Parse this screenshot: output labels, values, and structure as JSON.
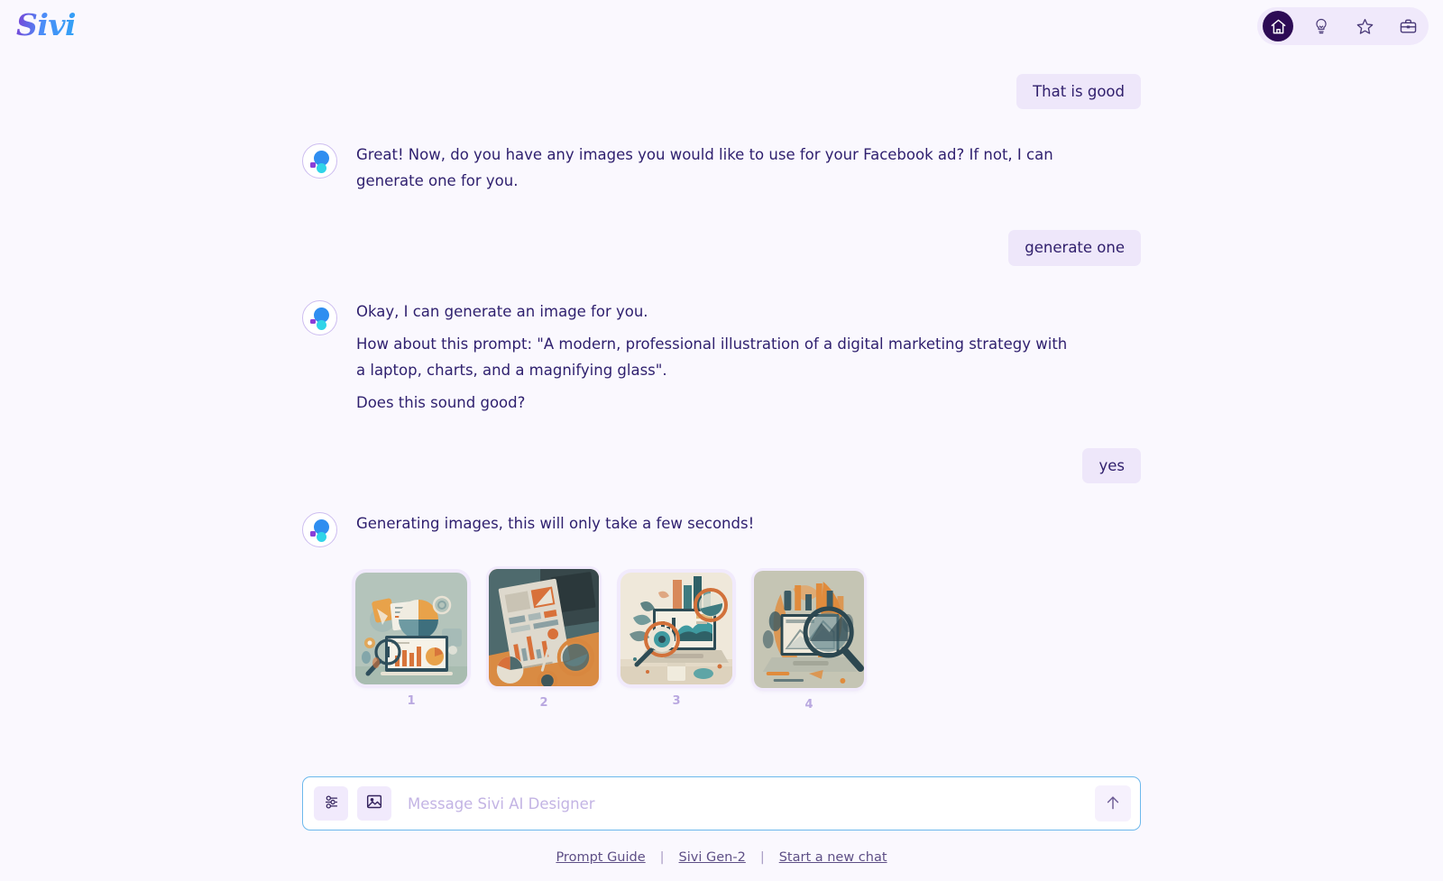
{
  "app": {
    "brand": "Sivi",
    "background_color": "#faf8fe",
    "accent_color": "#2d0b55",
    "bubble_color": "#eee7fa",
    "input_border_color": "#6cb8ec"
  },
  "header": {
    "nav": [
      {
        "label": "Home",
        "icon": "home-icon",
        "active": true
      },
      {
        "label": "Ideas",
        "icon": "lightbulb-icon",
        "active": false
      },
      {
        "label": "Favorites",
        "icon": "star-icon",
        "active": false
      },
      {
        "label": "Workspace",
        "icon": "briefcase-icon",
        "active": false
      }
    ]
  },
  "conversation": [
    {
      "role": "user",
      "text": "That is good"
    },
    {
      "role": "assistant",
      "paragraphs": [
        "Great! Now, do you have any images you would like to use for your Facebook ad? If not, I can generate one for you."
      ]
    },
    {
      "role": "user",
      "text": "generate one"
    },
    {
      "role": "assistant",
      "paragraphs": [
        "Okay, I can generate an image for you.",
        "How about this prompt: \"A modern, professional illustration of a digital marketing strategy with a laptop, charts, and a magnifying glass\".",
        "Does this sound good?"
      ]
    },
    {
      "role": "user",
      "text": "yes"
    },
    {
      "role": "assistant",
      "paragraphs": [
        "Generating images, this will only take a few seconds!"
      ]
    }
  ],
  "messages": {
    "m1_user": "That is good",
    "m2_bot_p1": "Great! Now, do you have any images you would like to use for your Facebook ad? If not, I can generate one for you.",
    "m3_user": "generate one",
    "m4_bot_p1": "Okay, I can generate an image for you.",
    "m4_bot_p2": "How about this prompt: \"A modern, professional illustration of a digital marketing strategy with a laptop, charts, and a magnifying glass\".",
    "m4_bot_p3": "Does this sound good?",
    "m5_user": "yes",
    "m6_bot_p1": "Generating images, this will only take a few seconds!"
  },
  "generated_images": [
    {
      "number": "1",
      "alt": "flat illustration of laptop with pie chart, bar chart and magnifying glass on sage green background"
    },
    {
      "number": "2",
      "alt": "photo of printed infographic report sheet on orange desk beside laptop keyboard"
    },
    {
      "number": "3",
      "alt": "painterly illustration of laptop showing teal area chart with magnifying glasses and coffee cup"
    },
    {
      "number": "4",
      "alt": "illustration of laptop with line graph and large magnifying glass over orange foliage"
    }
  ],
  "composer": {
    "placeholder": "Message Sivi AI Designer",
    "value": "",
    "settings_icon": "sliders-icon",
    "image_icon": "image-icon",
    "send_icon": "arrow-up-icon"
  },
  "footer": {
    "links": [
      {
        "label": "Prompt Guide"
      },
      {
        "label": "Sivi Gen-2"
      },
      {
        "label": "Start a new chat"
      }
    ],
    "separator": "|"
  }
}
